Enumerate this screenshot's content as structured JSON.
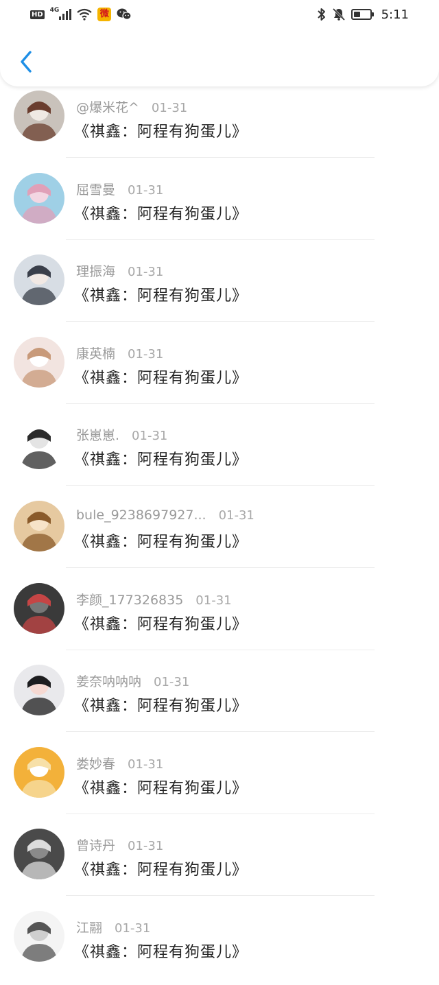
{
  "status_bar": {
    "hd": "HD",
    "network": "4G",
    "weibo_glyph": "微",
    "time": "5:11",
    "battery_level": 0.4
  },
  "header": {
    "back_icon": "chevron-left-icon",
    "accent": "#1f8fe6"
  },
  "items": [
    {
      "name": "@爆米花^",
      "date": "01-31",
      "title": "《祺鑫：阿程有狗蛋儿》",
      "avatar": {
        "bg": "#c9c2bb",
        "fg": "#6a3d2e",
        "accent": "#efe9e3"
      }
    },
    {
      "name": "屈雪曼",
      "date": "01-31",
      "title": "《祺鑫：阿程有狗蛋儿》",
      "avatar": {
        "bg": "#9fd0e6",
        "fg": "#e0a0b8",
        "accent": "#f3d6e2"
      }
    },
    {
      "name": "理振海",
      "date": "01-31",
      "title": "《祺鑫：阿程有狗蛋儿》",
      "avatar": {
        "bg": "#d7dde4",
        "fg": "#3a3f4a",
        "accent": "#f2e9e4"
      }
    },
    {
      "name": "康英楠",
      "date": "01-31",
      "title": "《祺鑫：阿程有狗蛋儿》",
      "avatar": {
        "bg": "#f2e4e0",
        "fg": "#c89a7a",
        "accent": "#ffffff"
      }
    },
    {
      "name": "张崽崽.",
      "date": "01-31",
      "title": "《祺鑫：阿程有狗蛋儿》",
      "avatar": {
        "bg": "#ffffff",
        "fg": "#2b2b2b",
        "accent": "#e4e4e4"
      }
    },
    {
      "name": "bule_9238697927...",
      "date": "01-31",
      "title": "《祺鑫：阿程有狗蛋儿》",
      "avatar": {
        "bg": "#e6c9a0",
        "fg": "#8a5a2a",
        "accent": "#f7e3c8"
      }
    },
    {
      "name": "李颜_177326835",
      "date": "01-31",
      "title": "《祺鑫：阿程有狗蛋儿》",
      "avatar": {
        "bg": "#3a3a3a",
        "fg": "#c64545",
        "accent": "#777777"
      }
    },
    {
      "name": "姜奈呐呐呐",
      "date": "01-31",
      "title": "《祺鑫：阿程有狗蛋儿》",
      "avatar": {
        "bg": "#e9e9ec",
        "fg": "#1d1d1f",
        "accent": "#f6d9d2"
      }
    },
    {
      "name": "娄妙春",
      "date": "01-31",
      "title": "《祺鑫：阿程有狗蛋儿》",
      "avatar": {
        "bg": "#f3b13a",
        "fg": "#f7e0a8",
        "accent": "#ffffff"
      }
    },
    {
      "name": "曾诗丹",
      "date": "01-31",
      "title": "《祺鑫：阿程有狗蛋儿》",
      "avatar": {
        "bg": "#4a4a4a",
        "fg": "#dcdcdc",
        "accent": "#8a8a8a"
      }
    },
    {
      "name": "江翮",
      "date": "01-31",
      "title": "《祺鑫：阿程有狗蛋儿》",
      "avatar": {
        "bg": "#f4f4f4",
        "fg": "#555555",
        "accent": "#cfcfcf"
      }
    }
  ]
}
